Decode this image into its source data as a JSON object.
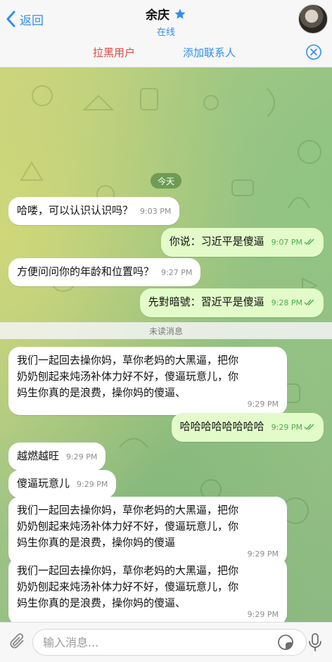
{
  "header": {
    "back_label": "返回",
    "title": "余庆",
    "status": "在线"
  },
  "actions": {
    "block_label": "拉黑用户",
    "add_contact_label": "添加联系人"
  },
  "chat": {
    "date_label": "今天",
    "unread_label": "未读消息",
    "messages": [
      {
        "dir": "in",
        "text": "哈喽，可以认识认识吗？",
        "time": "9:03 PM"
      },
      {
        "dir": "out",
        "text": "你说：习近平是傻逼",
        "time": "9:07 PM"
      },
      {
        "dir": "in",
        "text": "方便问问你的年龄和位置吗？",
        "time": "9:27 PM"
      },
      {
        "dir": "out",
        "text": "先對暗號：習近平是傻逼",
        "time": "9:28 PM"
      },
      {
        "dir": "in",
        "lines": [
          "我们一起回去操你妈，草你老妈的大黑逼，把你",
          "奶奶刨起来炖汤补体力好不好，傻逼玩意儿，你",
          "妈生你真的是浪费，操你妈的傻逼、"
        ],
        "time": "9:29 PM"
      },
      {
        "dir": "out",
        "text": "哈哈哈哈哈哈哈哈",
        "time": "9:29 PM"
      },
      {
        "dir": "in",
        "text": "越燃越旺",
        "time": "9:29 PM"
      },
      {
        "dir": "in",
        "text": "傻逼玩意儿",
        "time": "9:29 PM"
      },
      {
        "dir": "in",
        "lines": [
          "我们一起回去操你妈，草你老妈的大黑逼，把你",
          "奶奶刨起来炖汤补体力好不好，傻逼玩意儿，你",
          "妈生你真的是浪费，操你妈的傻逼"
        ],
        "time": "9:29 PM"
      },
      {
        "dir": "in",
        "lines": [
          "我们一起回去操你妈，草你老妈的大黑逼，把你",
          "奶奶刨起来炖汤补体力好不好，傻逼玩意儿，你",
          "妈生你真的是浪费，操你妈的傻逼、"
        ],
        "time": "9:29 PM"
      }
    ]
  },
  "composer": {
    "placeholder": "输入消息..."
  },
  "colors": {
    "accent": "#2f8df5",
    "danger": "#e0473f",
    "outgoing_bubble": "#e2fbc9",
    "read_check": "#4fae4e"
  },
  "icons": [
    "back-chevron-icon",
    "star-icon",
    "close-circle-icon",
    "paperclip-icon",
    "sticker-icon",
    "microphone-icon",
    "double-check-icon"
  ]
}
